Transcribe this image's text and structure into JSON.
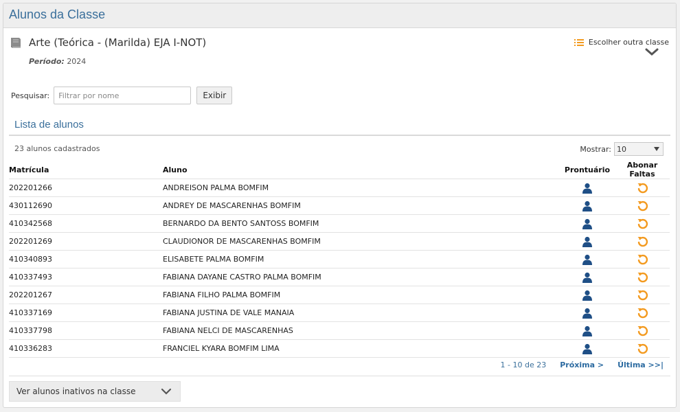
{
  "header": {
    "title": "Alunos da Classe"
  },
  "class_info": {
    "name": "Arte (Teórica - (Marilda) EJA I-NOT)",
    "period_label": "Período:",
    "period_value": "2024",
    "choose_label": "Escolher outra classe"
  },
  "search": {
    "label": "Pesquisar:",
    "placeholder": "Filtrar por nome",
    "value": "",
    "button_label": "Exibir"
  },
  "list": {
    "title": "Lista de alunos",
    "count_text": "23 alunos cadastrados",
    "show_label": "Mostrar:",
    "show_value": "10",
    "columns": [
      "Matrícula",
      "Aluno",
      "Prontuário",
      "Abonar Faltas"
    ],
    "rows": [
      {
        "matricula": "202201266",
        "aluno": "ANDREISON PALMA BOMFIM"
      },
      {
        "matricula": "430112690",
        "aluno": "ANDREY DE MASCARENHAS BOMFIM"
      },
      {
        "matricula": "410342568",
        "aluno": "BERNARDO DA BENTO SANTOSS BOMFIM"
      },
      {
        "matricula": "202201269",
        "aluno": "CLAUDIONOR DE MASCARENHAS BOMFIM"
      },
      {
        "matricula": "410340893",
        "aluno": "ELISABETE PALMA BOMFIM"
      },
      {
        "matricula": "410337493",
        "aluno": "FABIANA DAYANE CASTRO PALMA BOMFIM"
      },
      {
        "matricula": "202201267",
        "aluno": "FABIANA FILHO PALMA BOMFIM"
      },
      {
        "matricula": "410337169",
        "aluno": "FABIANA JUSTINA DE VALE MANAIA"
      },
      {
        "matricula": "410337798",
        "aluno": "FABIANA NELCI DE MASCARENHAS"
      },
      {
        "matricula": "410336283",
        "aluno": "FRANCIEL KYARA BOMFIM LIMA"
      }
    ]
  },
  "pagination": {
    "info": "1 - 10 de 23",
    "next_label": "Próxima >",
    "last_label": "Última >>|"
  },
  "inactive": {
    "label": "Ver alunos inativos na classe"
  },
  "icons": {
    "book": "book-icon",
    "list": "list-icon",
    "chevron": "chevron-down-icon",
    "prontuario": "user-icon",
    "abonar": "undo-icon",
    "dropdown": "dropdown-arrow-icon"
  },
  "colors": {
    "title": "#3a6f9b",
    "user_icon": "#1f4f86",
    "undo_icon": "#f39a1f",
    "list_icon": "#f39a1f"
  }
}
